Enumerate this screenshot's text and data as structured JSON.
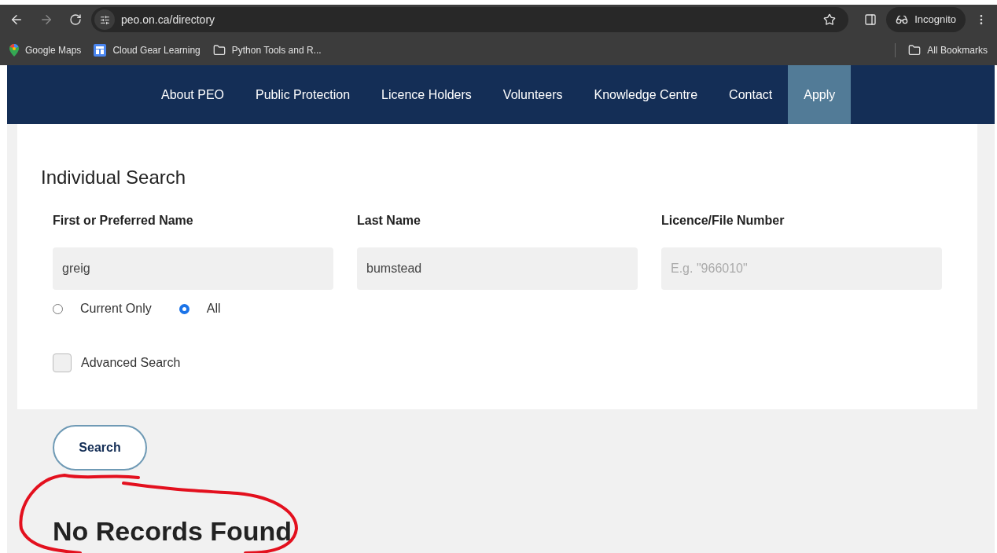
{
  "browser": {
    "url": "peo.on.ca/directory",
    "profile": "Incognito",
    "bookmarks": [
      {
        "label": "Google Maps",
        "kind": "maps"
      },
      {
        "label": "Cloud Gear Learning",
        "kind": "app"
      },
      {
        "label": "Python Tools and R...",
        "kind": "folder"
      }
    ],
    "all_bookmarks": "All Bookmarks"
  },
  "nav": [
    {
      "label": "About PEO",
      "selected": false
    },
    {
      "label": "Public Protection",
      "selected": false
    },
    {
      "label": "Licence Holders",
      "selected": false
    },
    {
      "label": "Volunteers",
      "selected": false
    },
    {
      "label": "Knowledge Centre",
      "selected": false
    },
    {
      "label": "Contact",
      "selected": false
    },
    {
      "label": "Apply",
      "selected": true
    }
  ],
  "search": {
    "title": "Individual Search",
    "fields": [
      {
        "label": "First or Preferred Name",
        "value": "greig"
      },
      {
        "label": "Last Name",
        "value": "bumstead"
      },
      {
        "label": "Licence/File Number",
        "placeholder": "E.g. \"966010\""
      }
    ],
    "status_options": [
      {
        "label": "Current Only",
        "selected": false
      },
      {
        "label": "All",
        "selected": true
      }
    ],
    "advanced": {
      "label": "Advanced Search",
      "checked": false
    },
    "button": "Search",
    "result": "No Records Found"
  }
}
